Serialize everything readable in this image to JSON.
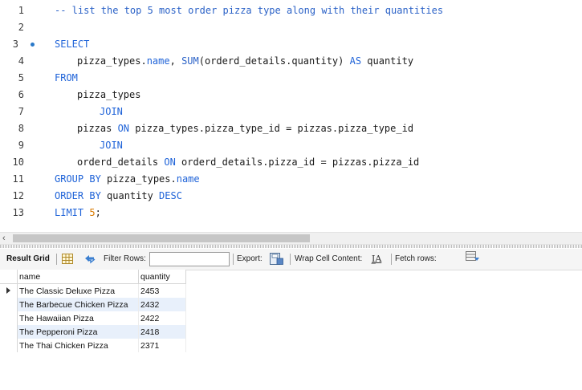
{
  "editor": {
    "line_numbers": [
      "1",
      "2",
      "3",
      "4",
      "5",
      "6",
      "7",
      "8",
      "9",
      "10",
      "11",
      "12",
      "13"
    ],
    "line1_comment": "-- list the top 5 most order pizza type along with their quantities",
    "line3_select": "SELECT",
    "line4_a": "pizza_types.",
    "line4_name": "name",
    "line4_sep": ", ",
    "line4_sum": "SUM",
    "line4_b": "(orderd_details.quantity) ",
    "line4_as": "AS",
    "line4_c": " quantity",
    "line5_from": "FROM",
    "line6": "pizza_types",
    "line7_join": "JOIN",
    "line8_a": "pizzas ",
    "line8_on": "ON",
    "line8_b": " pizza_types.pizza_type_id = pizzas.pizza_type_id",
    "line9_join": "JOIN",
    "line10_a": "orderd_details ",
    "line10_on": "ON",
    "line10_b": " orderd_details.pizza_id = pizzas.pizza_id",
    "line11_groupby": "GROUP BY",
    "line11_a": " pizza_types.",
    "line11_name": "name",
    "line12_orderby": "ORDER BY",
    "line12_a": " quantity ",
    "line12_desc": "DESC",
    "line13_limit": "LIMIT",
    "line13_sp": " ",
    "line13_num": "5",
    "line13_semi": ";"
  },
  "toolbar": {
    "result_grid": "Result Grid",
    "filter_rows": "Filter Rows:",
    "export": "Export:",
    "wrap_cell": "Wrap Cell Content:",
    "fetch_rows": "Fetch rows:"
  },
  "grid": {
    "columns": [
      "name",
      "quantity"
    ],
    "rows": [
      {
        "name": "The Classic Deluxe Pizza",
        "quantity": "2453"
      },
      {
        "name": "The Barbecue Chicken Pizza",
        "quantity": "2432"
      },
      {
        "name": "The Hawaiian Pizza",
        "quantity": "2422"
      },
      {
        "name": "The Pepperoni Pizza",
        "quantity": "2418"
      },
      {
        "name": "The Thai Chicken Pizza",
        "quantity": "2371"
      }
    ]
  },
  "colors": {
    "keyword": "#1f63d8",
    "number": "#d97a00",
    "row_alt": "#e8f0fb"
  }
}
